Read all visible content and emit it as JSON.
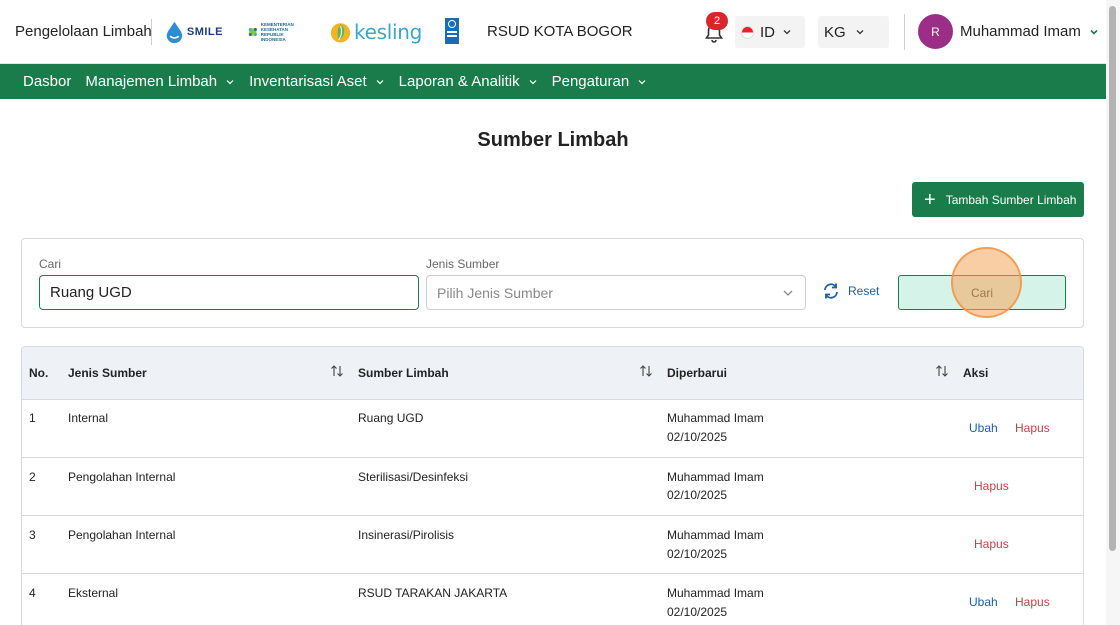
{
  "header": {
    "app_title": "Pengelolaan Limbah",
    "logos": {
      "smile": "SMILE",
      "kemenkes": "KEMENTERIAN KESEHATAN REPUBLIK INDONESIA",
      "kesling": "kesling"
    },
    "hospital": "RSUD KOTA BOGOR",
    "notification_count": "2",
    "language": "ID",
    "unit": "KG",
    "avatar_initial": "R",
    "user_name": "Muhammad Imam"
  },
  "nav": {
    "items": [
      {
        "label": "Dasbor",
        "dropdown": false
      },
      {
        "label": "Manajemen Limbah",
        "dropdown": true
      },
      {
        "label": "Inventarisasi Aset",
        "dropdown": true
      },
      {
        "label": "Laporan & Analitik",
        "dropdown": true
      },
      {
        "label": "Pengaturan",
        "dropdown": true
      }
    ]
  },
  "page": {
    "title": "Sumber Limbah",
    "add_button": "Tambah Sumber Limbah"
  },
  "filter": {
    "search_label": "Cari",
    "search_value": "Ruang UGD",
    "type_label": "Jenis Sumber",
    "type_placeholder": "Pilih Jenis Sumber",
    "reset_label": "Reset",
    "search_button": "Cari"
  },
  "table": {
    "headers": {
      "no": "No.",
      "type": "Jenis Sumber",
      "source": "Sumber Limbah",
      "updated": "Diperbarui",
      "action": "Aksi"
    },
    "edit_label": "Ubah",
    "delete_label": "Hapus",
    "rows": [
      {
        "no": "1",
        "type": "Internal",
        "source": "Ruang UGD",
        "updated_by": "Muhammad Imam",
        "updated_at": "02/10/2025",
        "can_edit": true
      },
      {
        "no": "2",
        "type": "Pengolahan Internal",
        "source": "Sterilisasi/Desinfeksi",
        "updated_by": "Muhammad Imam",
        "updated_at": "02/10/2025",
        "can_edit": false
      },
      {
        "no": "3",
        "type": "Pengolahan Internal",
        "source": "Insinerasi/Pirolisis",
        "updated_by": "Muhammad Imam",
        "updated_at": "02/10/2025",
        "can_edit": false
      },
      {
        "no": "4",
        "type": "Eksternal",
        "source": "RSUD TARAKAN JAKARTA",
        "updated_by": "Muhammad Imam",
        "updated_at": "02/10/2025",
        "can_edit": true
      }
    ]
  },
  "colors": {
    "brand_green": "#1a7c4b",
    "link_blue": "#1a5ea8",
    "delete_red": "#c4414a",
    "avatar": "#9b2f88",
    "badge": "#d8262d"
  }
}
